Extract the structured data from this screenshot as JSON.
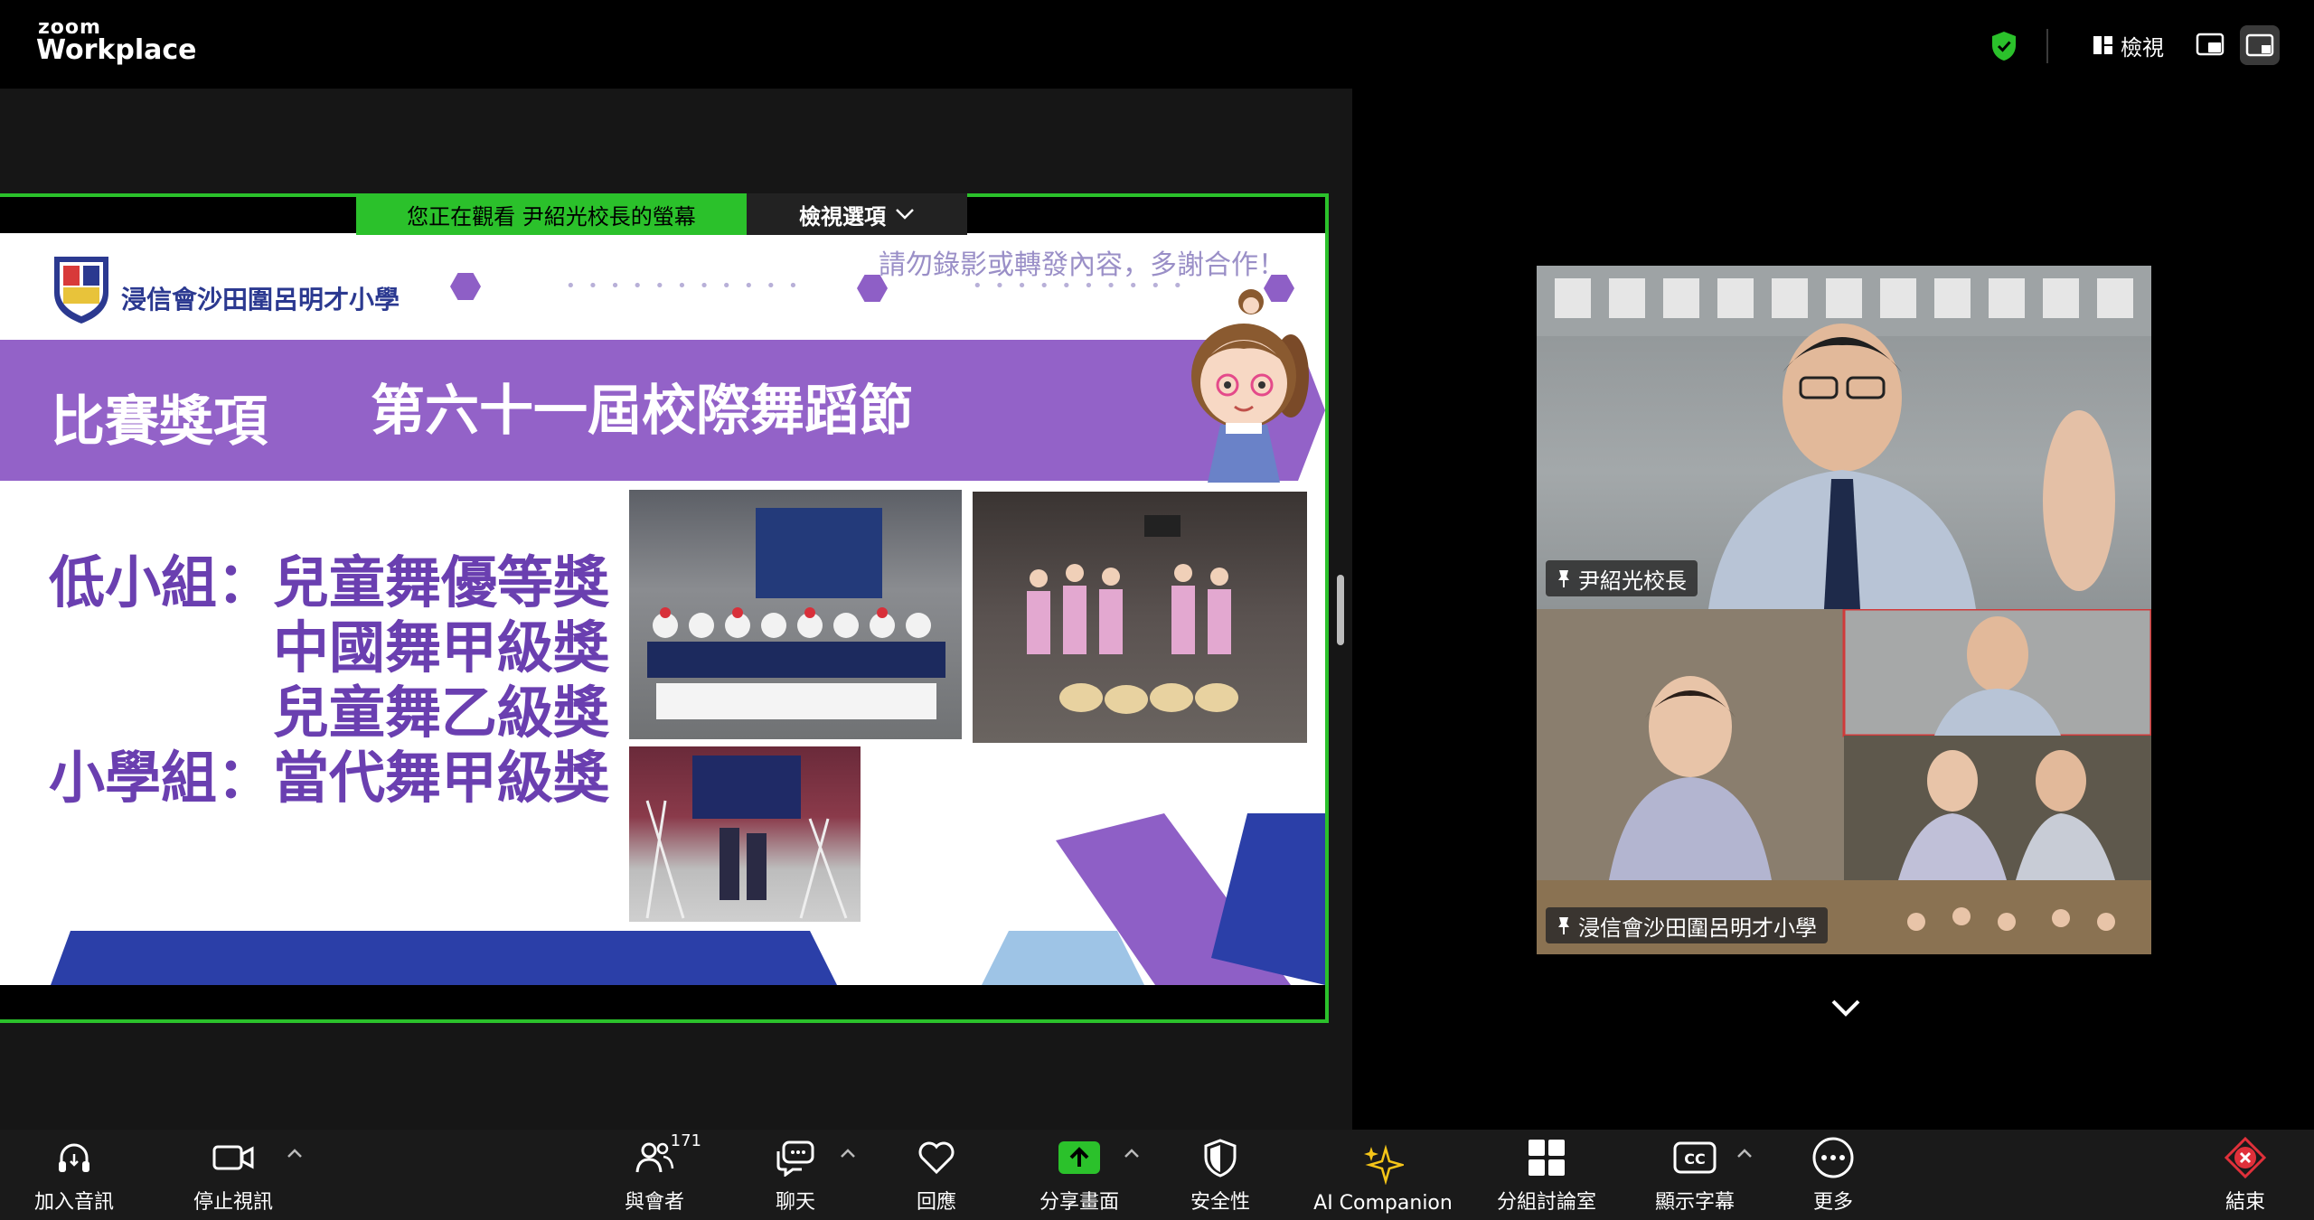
{
  "app": {
    "brand_small": "zoom",
    "brand_large": "Workplace"
  },
  "topbar": {
    "view_label": "檢視"
  },
  "share": {
    "viewing_text": "您正在觀看 尹紹光校長的螢幕",
    "view_options_label": "檢視選項"
  },
  "slide": {
    "school_name": "浸信會沙田圍呂明才小學",
    "notice": "請勿錄影或轉發內容，多謝合作！",
    "title_left": "比賽獎項",
    "title_right": "第六十一屆校際舞蹈節",
    "awards": [
      "低小組：兒童舞優等獎",
      "中國舞甲級獎",
      "兒童舞乙級獎",
      "小學組：當代舞甲級獎"
    ]
  },
  "videos": {
    "tile1_name": "尹紹光校長",
    "tile2_name": "浸信會沙田圍呂明才小學"
  },
  "toolbar": {
    "join_audio": "加入音訊",
    "stop_video": "停止視訊",
    "participants": "與會者",
    "participants_count": "171",
    "chat": "聊天",
    "reactions": "回應",
    "share_screen": "分享畫面",
    "security": "安全性",
    "ai_companion": "AI Companion",
    "breakout_rooms": "分組討論室",
    "captions": "顯示字幕",
    "more": "更多",
    "end": "結束"
  },
  "colors": {
    "accent_green": "#2bc12b",
    "slide_purple": "#9362c8",
    "slide_blue": "#2b3fa8",
    "end_red": "#e0303a"
  }
}
